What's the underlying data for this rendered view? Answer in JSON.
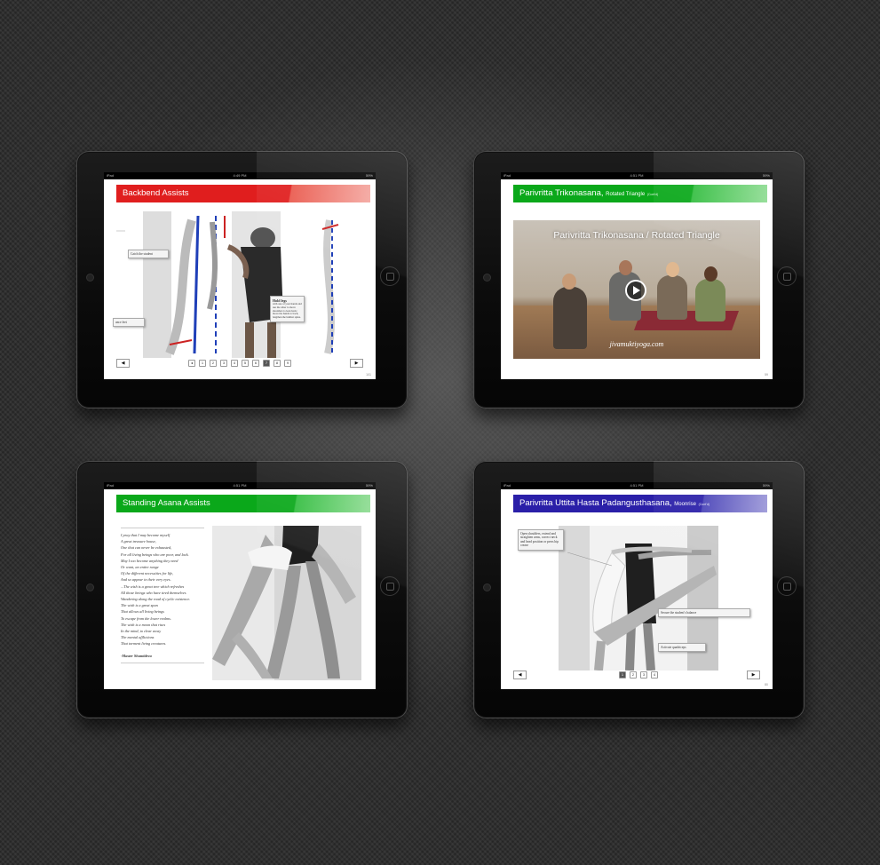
{
  "status": {
    "left": "iPad",
    "right": "59%"
  },
  "ipads": [
    {
      "time": "4:49 PM",
      "title": "Backbend Assists",
      "page_number": "101",
      "callouts": [
        "Catch the student",
        "ance feet"
      ],
      "callout_hold": {
        "title": "Hold legs",
        "body": "with one of your hands and use the other to move shoulders to lean back; move the hands to back, lengthen the lumbar spine."
      },
      "pager": [
        "◂",
        "1",
        "2",
        "3",
        "4",
        "5",
        "6",
        "7",
        "8",
        "9"
      ],
      "prev": "◀",
      "next": "▶"
    },
    {
      "time": "4:51 PM",
      "title": "Parivritta Trikonasana,",
      "subtitle": "Rotated Triangle",
      "cont": "(Cont'd)",
      "video_title": "Parivritta Trikonasana / Rotated Triangle",
      "watermark": "jivamuktiyoga.com",
      "page_number": "59",
      "play_icon": "play-icon"
    },
    {
      "time": "4:51 PM",
      "title": "Standing Asana Assists",
      "poem": [
        "I pray that I may become myself",
        "A great treasure house,",
        "One that can never be exhausted,",
        "For all living beings who are poor, and lack.",
        "May I too become anything they need",
        "Or want, an entire range",
        "Of the different necessities for life,",
        "And so appear in their very eyes.",
        "...The wish is a great tree which refreshes",
        "All those beings who have tired themselves",
        "Wandering along the road of cyclic existence.",
        "The wish is a great span",
        "That allows all living beings",
        "To escape from the lower realms.",
        "The wish is a moon that rises",
        "In the mind, to clear away",
        "The mental afflictions",
        "That torment living creatures."
      ],
      "author": "-Master Shantideva"
    },
    {
      "time": "4:51 PM",
      "title": "Parivritta Uttita Hasta Padangusthasana,",
      "subtitle": "Moonrise",
      "cont": "(Cont'd)",
      "page_number": "80",
      "callouts": [
        "Open shoulders, extend and straighten arms, correct neck and head position or press hip crease",
        "Secure the student's balance",
        "Activate quadriceps"
      ],
      "pager": [
        "1",
        "2",
        "3",
        "4"
      ],
      "prev": "◀",
      "next": "▶"
    }
  ]
}
